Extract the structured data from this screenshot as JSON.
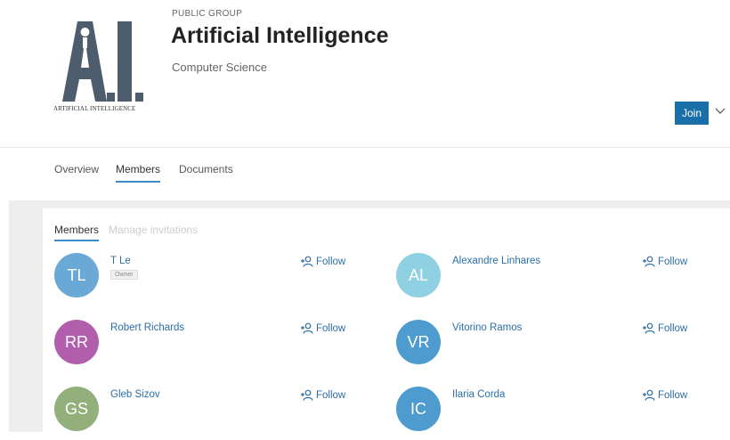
{
  "group": {
    "logo_caption": "ARTIFICIAL INTELLIGENCE",
    "eyebrow": "PUBLIC GROUP",
    "title": "Artificial Intelligence",
    "subtitle": "Computer Science",
    "join_label": "Join"
  },
  "tabs": [
    {
      "label": "Overview",
      "active": false
    },
    {
      "label": "Members",
      "active": true
    },
    {
      "label": "Documents",
      "active": false
    }
  ],
  "subtabs": [
    {
      "label": "Members",
      "active": true
    },
    {
      "label": "Manage invitations",
      "active": false
    }
  ],
  "follow_label": "Follow",
  "owner_badge": "Owner",
  "members": [
    {
      "initials": "TL",
      "name": "T Le",
      "color": "#6aa9d6",
      "badge": true
    },
    {
      "initials": "AL",
      "name": "Alexandre Linhares",
      "color": "#8fd0e3",
      "badge": false
    },
    {
      "initials": "RR",
      "name": "Robert Richards",
      "color": "#b15fac",
      "badge": false
    },
    {
      "initials": "VR",
      "name": "Vitorino Ramos",
      "color": "#4e9bcf",
      "badge": false
    },
    {
      "initials": "GS",
      "name": "Gleb Sizov",
      "color": "#93b07c",
      "badge": false
    },
    {
      "initials": "IC",
      "name": "Ilaria Corda",
      "color": "#4e9bcf",
      "badge": false
    }
  ],
  "colors": {
    "accent": "#1a6fa8",
    "link": "#2b6ea5"
  }
}
